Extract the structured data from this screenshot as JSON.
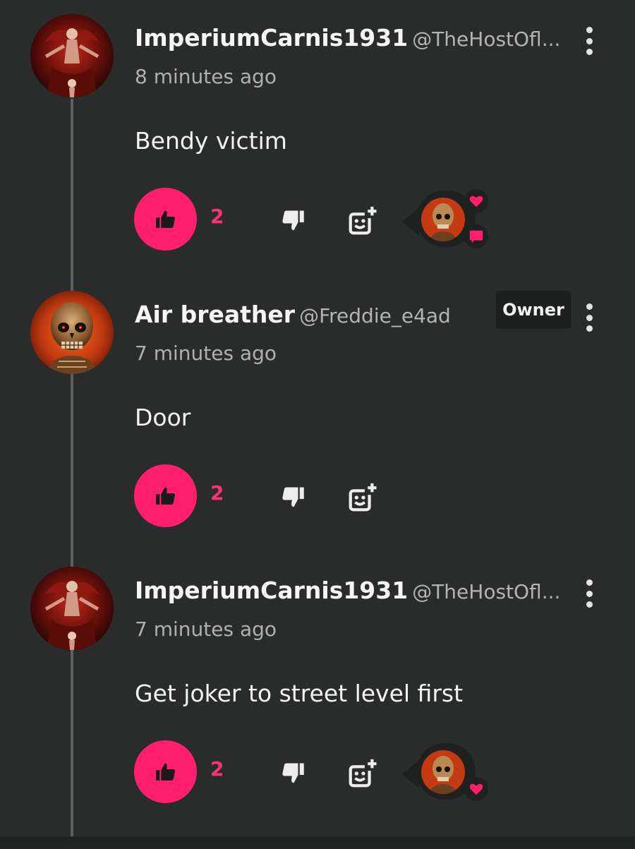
{
  "comments": [
    {
      "username": "ImperiumCarnis1931",
      "handle": "@TheHostOfl...",
      "time": "8 minutes ago",
      "text": "Bendy victim",
      "likes": "2",
      "avatar": "dark-red-figure-avatar",
      "has_reply_preview": true
    },
    {
      "username": "Air breather",
      "handle": "@Freddie_e4ad",
      "badge": "Owner",
      "time": "7 minutes ago",
      "text": "Door",
      "likes": "2",
      "avatar": "skull-avatar"
    },
    {
      "username": "ImperiumCarnis1931",
      "handle": "@TheHostOfl...",
      "time": "7 minutes ago",
      "text": "Get joker to street level first",
      "likes": "2",
      "avatar": "dark-red-figure-avatar",
      "has_reply_preview": true
    }
  ],
  "colors": {
    "background": "#2a2c2c",
    "accent": "#ff1f6e",
    "thread_line": "#5d5f60"
  },
  "icons": [
    "thumbs-up-icon",
    "thumbs-down-icon",
    "add-reaction-icon",
    "heart-icon",
    "chat-bubble-icon",
    "more-vert-icon"
  ]
}
